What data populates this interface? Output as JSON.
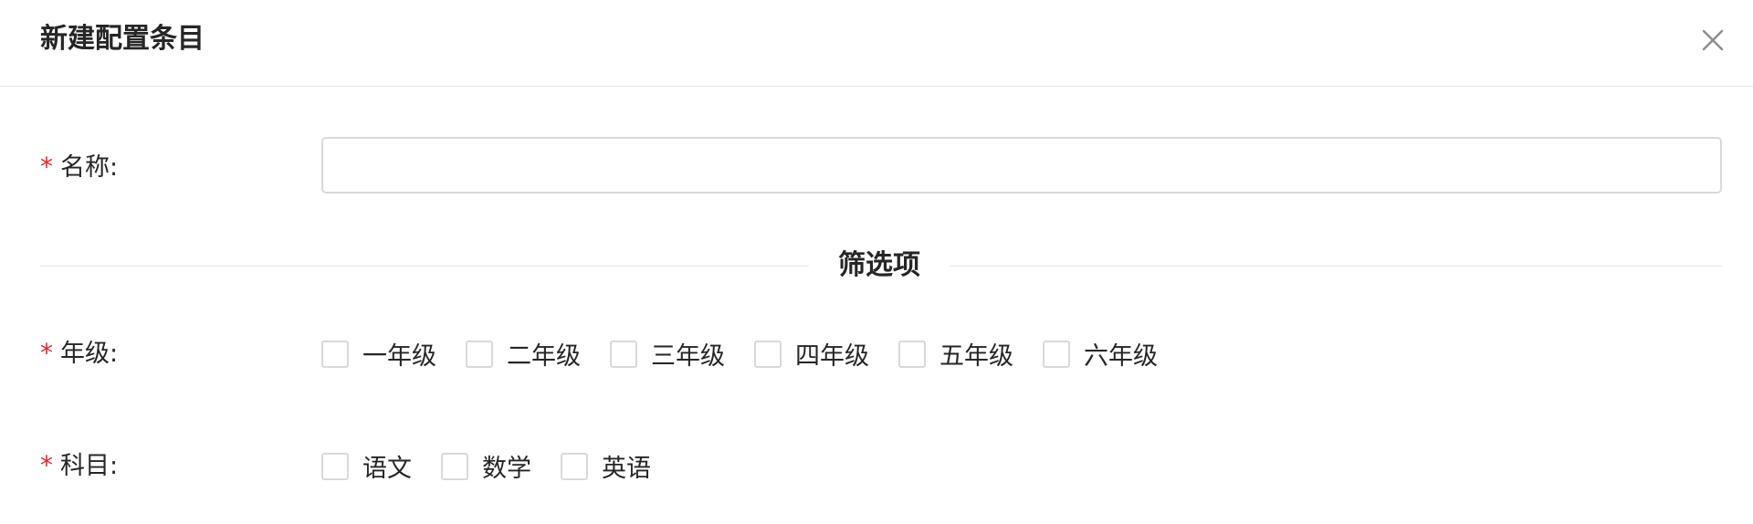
{
  "modal": {
    "title": "新建配置条目",
    "close_icon": "close-icon"
  },
  "form": {
    "required_mark": "*",
    "name": {
      "label": "名称:",
      "value": "",
      "placeholder": ""
    },
    "divider_text": "筛选项",
    "grade": {
      "label": "年级:",
      "options": [
        {
          "label": "一年级",
          "checked": false
        },
        {
          "label": "二年级",
          "checked": false
        },
        {
          "label": "三年级",
          "checked": false
        },
        {
          "label": "四年级",
          "checked": false
        },
        {
          "label": "五年级",
          "checked": false
        },
        {
          "label": "六年级",
          "checked": false
        }
      ]
    },
    "subject": {
      "label": "科目:",
      "options": [
        {
          "label": "语文",
          "checked": false
        },
        {
          "label": "数学",
          "checked": false
        },
        {
          "label": "英语",
          "checked": false
        }
      ]
    }
  },
  "colors": {
    "required": "#f5222d",
    "border": "#d9d9d9",
    "divider": "#e8e8e8",
    "text": "#262626"
  }
}
